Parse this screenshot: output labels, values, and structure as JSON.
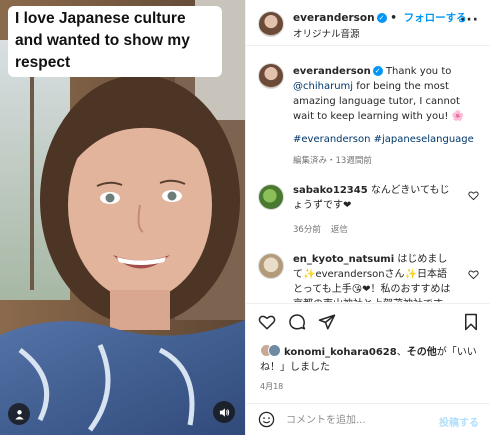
{
  "video": {
    "caption": "I love Japanese culture and wanted to show my respect",
    "icons": {
      "user": "person-icon",
      "sound": "speaker-icon"
    }
  },
  "header": {
    "username": "everanderson",
    "separator": "•",
    "follow_label": "フォローする",
    "audio_label": "オリジナル音源",
    "more_label": "···"
  },
  "post": {
    "username": "everanderson",
    "text_before_mention": "Thank you to",
    "mention": "@chiharumj",
    "text_after_mention": "for being the most amazing language tutor, I cannot wait to keep learning with you! 🌸",
    "hashtags": "#everanderson #japaneselanguage",
    "meta": "編集済み・13週間前"
  },
  "comments": [
    {
      "username": "sabako12345",
      "text": "なんどきいてもじょうずです❤",
      "time": "36分前",
      "reply_label": "返信"
    },
    {
      "username": "en_kyoto_natsumi",
      "text": "はじめまして✨everandersonさん✨日本語とっても上手😘❤！私のおすすめは京都の東山神社と上賀茂神社です👍 伝統の美しさが素晴らしいです。"
    }
  ],
  "actions": {
    "liked_user": "konomi_kohara0628",
    "liked_connector": "、",
    "liked_others": "その他",
    "liked_suffix": "が「いいね！」しました",
    "date": "4月18"
  },
  "composer": {
    "placeholder": "コメントを追加...",
    "post_label": "投稿する"
  },
  "colors": {
    "accent": "#0095f6",
    "verified": "#0095f6",
    "post_disabled": "#b2dffc",
    "link": "#00376b"
  }
}
